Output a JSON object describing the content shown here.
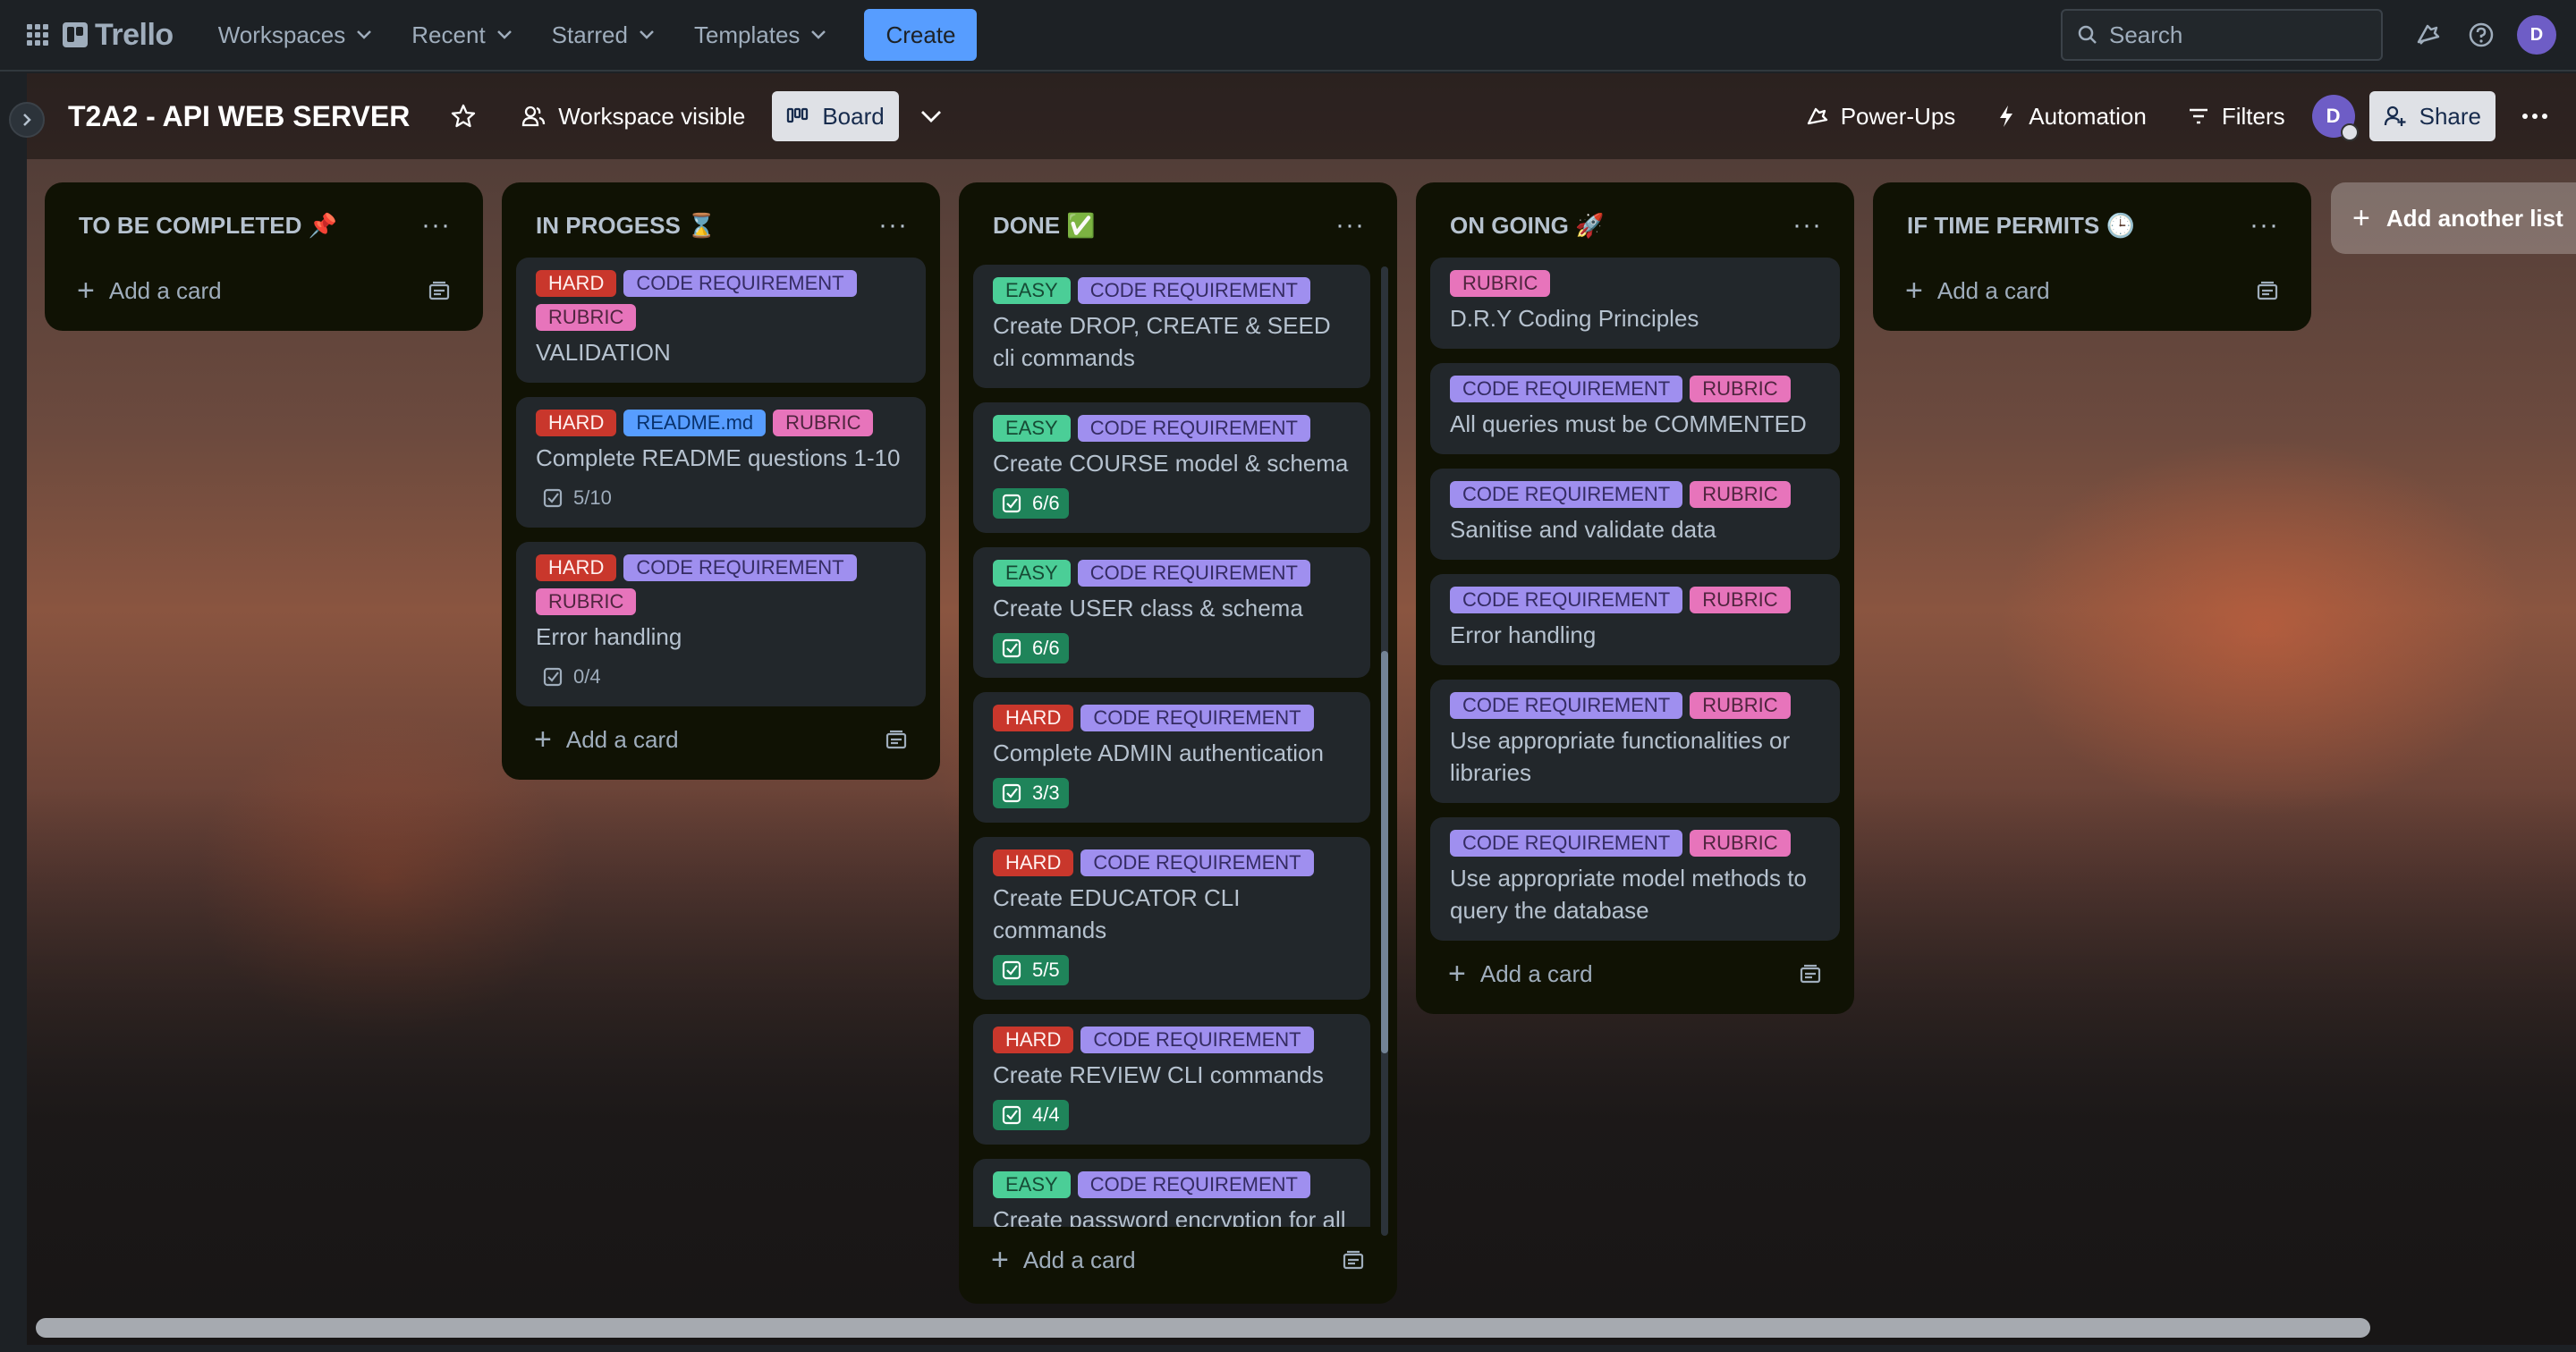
{
  "topnav": {
    "logo_text": "Trello",
    "items": [
      {
        "label": "Workspaces"
      },
      {
        "label": "Recent"
      },
      {
        "label": "Starred"
      },
      {
        "label": "Templates"
      }
    ],
    "create_label": "Create",
    "search_placeholder": "Search",
    "avatar_initial": "D"
  },
  "board_header": {
    "title": "T2A2 - API WEB SERVER",
    "visibility_label": "Workspace visible",
    "view_label": "Board",
    "powerups_label": "Power-Ups",
    "automation_label": "Automation",
    "filters_label": "Filters",
    "member_initial": "D",
    "share_label": "Share"
  },
  "add_card_label": "Add a card",
  "add_list_label": "Add another list",
  "lists": [
    {
      "title": "TO BE COMPLETED 📌",
      "cards": []
    },
    {
      "title": "IN PROGESS ⌛",
      "cards": [
        {
          "labels": [
            "HARD",
            "CODE REQUIREMENT",
            "RUBRIC"
          ],
          "title": "VALIDATION"
        },
        {
          "labels": [
            "HARD",
            "README.md",
            "RUBRIC"
          ],
          "title": "Complete README questions 1-10",
          "checklist": "5/10"
        },
        {
          "labels": [
            "HARD",
            "CODE REQUIREMENT",
            "RUBRIC"
          ],
          "title": "Error handling",
          "checklist": "0/4"
        }
      ]
    },
    {
      "title": "DONE ✅",
      "cards": [
        {
          "labels": [
            "EASY",
            "CODE REQUIREMENT"
          ],
          "title": "Create DROP, CREATE & SEED cli commands"
        },
        {
          "labels": [
            "EASY",
            "CODE REQUIREMENT"
          ],
          "title": "Create COURSE model & schema",
          "checklist": "6/6"
        },
        {
          "labels": [
            "EASY",
            "CODE REQUIREMENT"
          ],
          "title": "Create USER class & schema",
          "checklist": "6/6"
        },
        {
          "labels": [
            "HARD",
            "CODE REQUIREMENT"
          ],
          "title": "Complete ADMIN authentication",
          "checklist": "3/3"
        },
        {
          "labels": [
            "HARD",
            "CODE REQUIREMENT"
          ],
          "title": "Create EDUCATOR CLI commands",
          "checklist": "5/5"
        },
        {
          "labels": [
            "HARD",
            "CODE REQUIREMENT"
          ],
          "title": "Create REVIEW CLI commands",
          "checklist": "4/4"
        },
        {
          "labels": [
            "EASY",
            "CODE REQUIREMENT"
          ],
          "title": "Create password encryption for all"
        }
      ]
    },
    {
      "title": "ON GOING 🚀",
      "cards": [
        {
          "labels": [
            "RUBRIC"
          ],
          "title": "D.R.Y Coding Principles"
        },
        {
          "labels": [
            "CODE REQUIREMENT",
            "RUBRIC"
          ],
          "title": "All queries must be COMMENTED"
        },
        {
          "labels": [
            "CODE REQUIREMENT",
            "RUBRIC"
          ],
          "title": "Sanitise and validate data"
        },
        {
          "labels": [
            "CODE REQUIREMENT",
            "RUBRIC"
          ],
          "title": "Error handling"
        },
        {
          "labels": [
            "CODE REQUIREMENT",
            "RUBRIC"
          ],
          "title": "Use appropriate functionalities or libraries"
        },
        {
          "labels": [
            "CODE REQUIREMENT",
            "RUBRIC"
          ],
          "title": "Use appropriate model methods to query the database"
        }
      ]
    },
    {
      "title": "IF TIME PERMITS 🕒",
      "cards": []
    }
  ],
  "label_colors": {
    "HARD": "#c9372c",
    "EASY": "#4bce97",
    "CODE REQUIREMENT": "#9f8fef",
    "RUBRIC": "#e774bb",
    "README.md": "#579dff"
  }
}
